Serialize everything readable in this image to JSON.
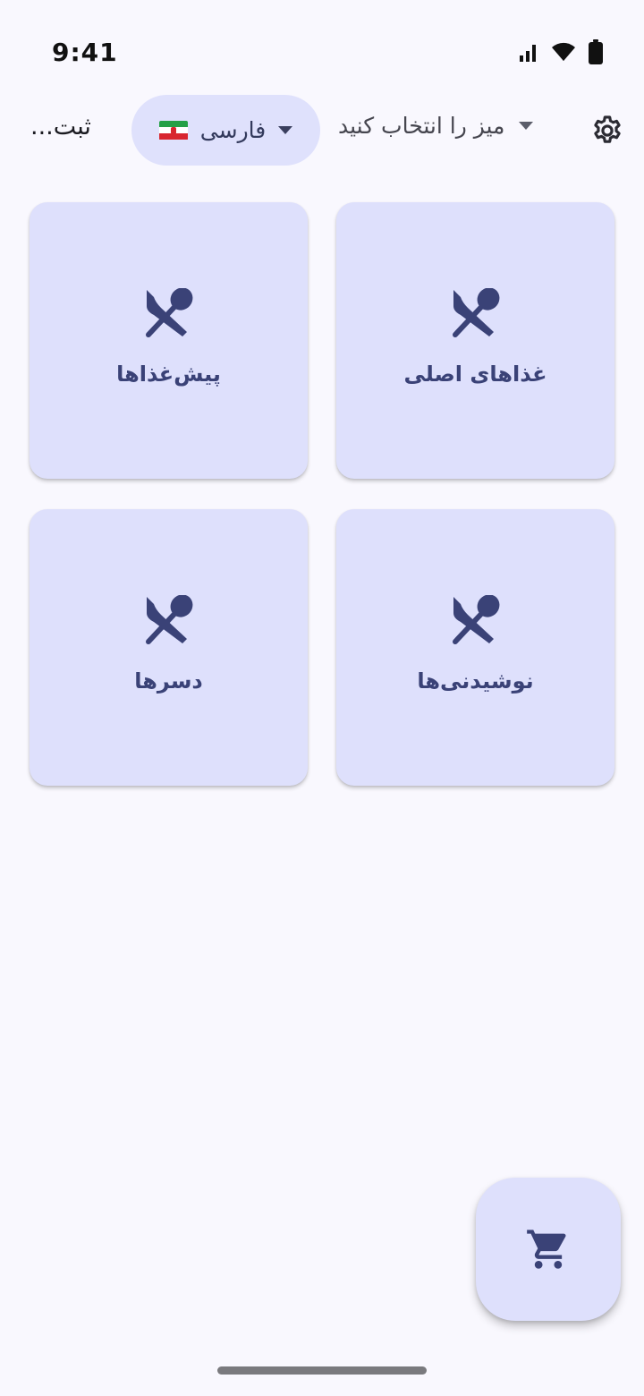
{
  "status": {
    "time": "9:41"
  },
  "header": {
    "submit_label": "ثبت...",
    "language": {
      "label": "فارسی",
      "flag": "iran-flag"
    },
    "table_select_placeholder": "میز را انتخاب کنید",
    "settings_icon": "gear-icon"
  },
  "categories": [
    {
      "label": "غذاهای اصلی",
      "icon": "silverware-icon"
    },
    {
      "label": "پیش‌غذاها",
      "icon": "silverware-icon"
    },
    {
      "label": "نوشیدنی‌ها",
      "icon": "silverware-icon"
    },
    {
      "label": "دسرها",
      "icon": "silverware-icon"
    }
  ],
  "fab": {
    "icon": "cart-icon"
  },
  "colors": {
    "card_bg": "#dee0fc",
    "accent": "#3a4277",
    "background": "#f9f8fe"
  }
}
